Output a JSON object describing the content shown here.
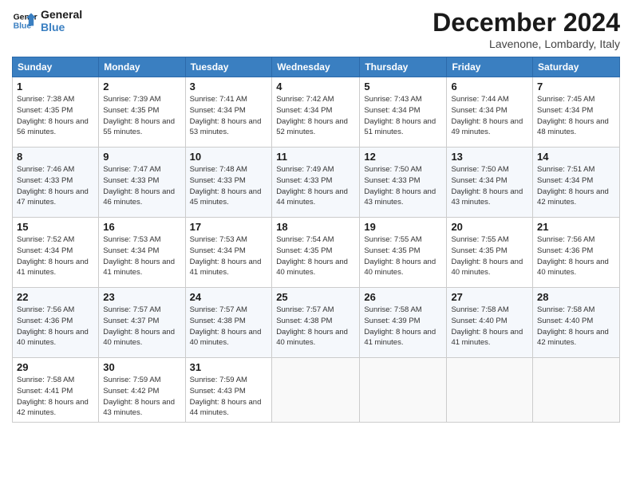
{
  "logo": {
    "line1": "General",
    "line2": "Blue"
  },
  "title": "December 2024",
  "subtitle": "Lavenone, Lombardy, Italy",
  "weekdays": [
    "Sunday",
    "Monday",
    "Tuesday",
    "Wednesday",
    "Thursday",
    "Friday",
    "Saturday"
  ],
  "weeks": [
    [
      {
        "day": "1",
        "sunrise": "7:38 AM",
        "sunset": "4:35 PM",
        "daylight": "8 hours and 56 minutes."
      },
      {
        "day": "2",
        "sunrise": "7:39 AM",
        "sunset": "4:35 PM",
        "daylight": "8 hours and 55 minutes."
      },
      {
        "day": "3",
        "sunrise": "7:41 AM",
        "sunset": "4:34 PM",
        "daylight": "8 hours and 53 minutes."
      },
      {
        "day": "4",
        "sunrise": "7:42 AM",
        "sunset": "4:34 PM",
        "daylight": "8 hours and 52 minutes."
      },
      {
        "day": "5",
        "sunrise": "7:43 AM",
        "sunset": "4:34 PM",
        "daylight": "8 hours and 51 minutes."
      },
      {
        "day": "6",
        "sunrise": "7:44 AM",
        "sunset": "4:34 PM",
        "daylight": "8 hours and 49 minutes."
      },
      {
        "day": "7",
        "sunrise": "7:45 AM",
        "sunset": "4:34 PM",
        "daylight": "8 hours and 48 minutes."
      }
    ],
    [
      {
        "day": "8",
        "sunrise": "7:46 AM",
        "sunset": "4:33 PM",
        "daylight": "8 hours and 47 minutes."
      },
      {
        "day": "9",
        "sunrise": "7:47 AM",
        "sunset": "4:33 PM",
        "daylight": "8 hours and 46 minutes."
      },
      {
        "day": "10",
        "sunrise": "7:48 AM",
        "sunset": "4:33 PM",
        "daylight": "8 hours and 45 minutes."
      },
      {
        "day": "11",
        "sunrise": "7:49 AM",
        "sunset": "4:33 PM",
        "daylight": "8 hours and 44 minutes."
      },
      {
        "day": "12",
        "sunrise": "7:50 AM",
        "sunset": "4:33 PM",
        "daylight": "8 hours and 43 minutes."
      },
      {
        "day": "13",
        "sunrise": "7:50 AM",
        "sunset": "4:34 PM",
        "daylight": "8 hours and 43 minutes."
      },
      {
        "day": "14",
        "sunrise": "7:51 AM",
        "sunset": "4:34 PM",
        "daylight": "8 hours and 42 minutes."
      }
    ],
    [
      {
        "day": "15",
        "sunrise": "7:52 AM",
        "sunset": "4:34 PM",
        "daylight": "8 hours and 41 minutes."
      },
      {
        "day": "16",
        "sunrise": "7:53 AM",
        "sunset": "4:34 PM",
        "daylight": "8 hours and 41 minutes."
      },
      {
        "day": "17",
        "sunrise": "7:53 AM",
        "sunset": "4:34 PM",
        "daylight": "8 hours and 41 minutes."
      },
      {
        "day": "18",
        "sunrise": "7:54 AM",
        "sunset": "4:35 PM",
        "daylight": "8 hours and 40 minutes."
      },
      {
        "day": "19",
        "sunrise": "7:55 AM",
        "sunset": "4:35 PM",
        "daylight": "8 hours and 40 minutes."
      },
      {
        "day": "20",
        "sunrise": "7:55 AM",
        "sunset": "4:35 PM",
        "daylight": "8 hours and 40 minutes."
      },
      {
        "day": "21",
        "sunrise": "7:56 AM",
        "sunset": "4:36 PM",
        "daylight": "8 hours and 40 minutes."
      }
    ],
    [
      {
        "day": "22",
        "sunrise": "7:56 AM",
        "sunset": "4:36 PM",
        "daylight": "8 hours and 40 minutes."
      },
      {
        "day": "23",
        "sunrise": "7:57 AM",
        "sunset": "4:37 PM",
        "daylight": "8 hours and 40 minutes."
      },
      {
        "day": "24",
        "sunrise": "7:57 AM",
        "sunset": "4:38 PM",
        "daylight": "8 hours and 40 minutes."
      },
      {
        "day": "25",
        "sunrise": "7:57 AM",
        "sunset": "4:38 PM",
        "daylight": "8 hours and 40 minutes."
      },
      {
        "day": "26",
        "sunrise": "7:58 AM",
        "sunset": "4:39 PM",
        "daylight": "8 hours and 41 minutes."
      },
      {
        "day": "27",
        "sunrise": "7:58 AM",
        "sunset": "4:40 PM",
        "daylight": "8 hours and 41 minutes."
      },
      {
        "day": "28",
        "sunrise": "7:58 AM",
        "sunset": "4:40 PM",
        "daylight": "8 hours and 42 minutes."
      }
    ],
    [
      {
        "day": "29",
        "sunrise": "7:58 AM",
        "sunset": "4:41 PM",
        "daylight": "8 hours and 42 minutes."
      },
      {
        "day": "30",
        "sunrise": "7:59 AM",
        "sunset": "4:42 PM",
        "daylight": "8 hours and 43 minutes."
      },
      {
        "day": "31",
        "sunrise": "7:59 AM",
        "sunset": "4:43 PM",
        "daylight": "8 hours and 44 minutes."
      },
      null,
      null,
      null,
      null
    ]
  ]
}
